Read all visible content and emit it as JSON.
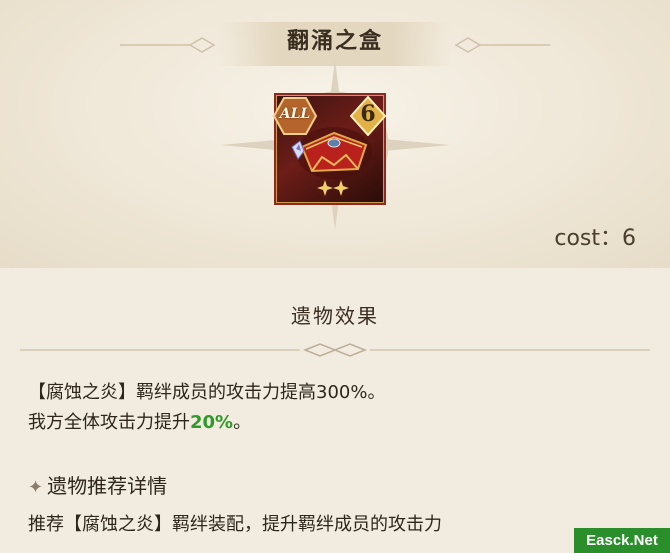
{
  "header": {
    "title": "翻涌之盒"
  },
  "item": {
    "badge_all": "ALL",
    "badge_cost": "6",
    "icon_name": "chest-icon"
  },
  "cost": {
    "label": "cost：",
    "value": "6"
  },
  "effect": {
    "header": "遗物效果",
    "line1": "【腐蚀之炎】羁绊成员的攻击力提高300%。",
    "line2_prefix": "我方全体攻击力提升",
    "line2_value": "20%",
    "line2_suffix": "。"
  },
  "recommend": {
    "star": "✦",
    "title": "遗物推荐详情",
    "body": "推荐【腐蚀之炎】羁绊装配，提升羁绊成员的攻击力"
  },
  "watermark": {
    "text": "Easck.Net"
  },
  "colors": {
    "highlight_green": "#2f9a2a",
    "frame_red": "#8c2a1f",
    "gold": "#d9a441"
  }
}
